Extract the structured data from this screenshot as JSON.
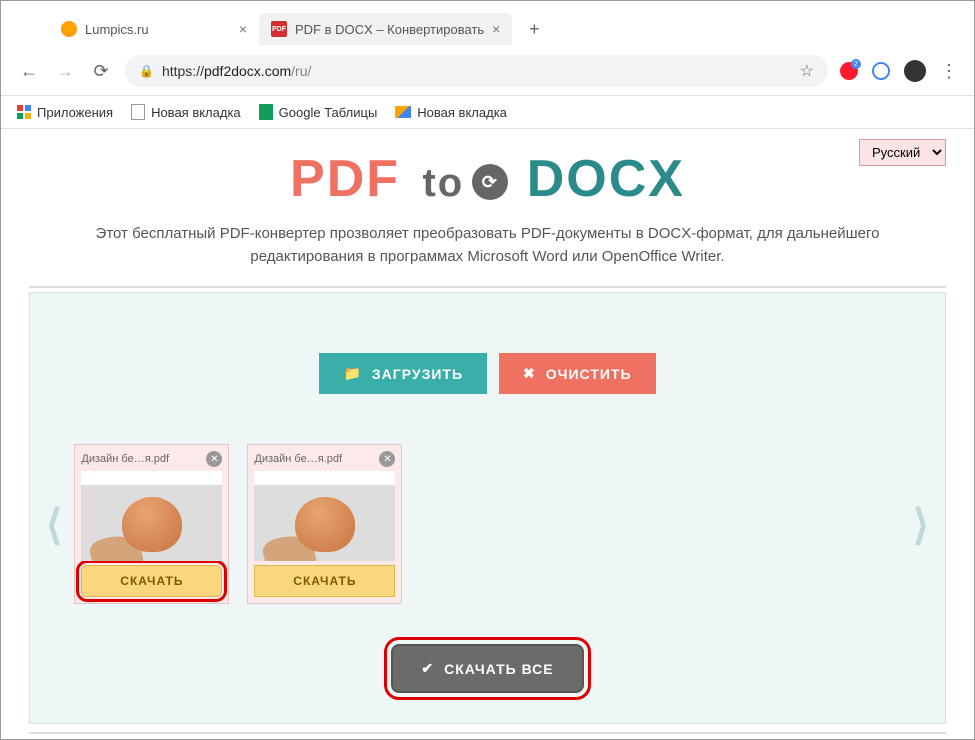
{
  "window": {
    "minimize": "—",
    "maximize": "☐",
    "close": "✕"
  },
  "tabs": [
    {
      "title": "Lumpics.ru"
    },
    {
      "title": "PDF в DOCX – Конвертировать"
    }
  ],
  "newTab": "+",
  "nav": {
    "back": "←",
    "forward": "→",
    "reload": "⟳"
  },
  "url": {
    "scheme": "https://",
    "domain": "pdf2docx.com",
    "path": "/ru/"
  },
  "star": "☆",
  "operaBadge": "2",
  "bookmarks": {
    "apps": "Приложения",
    "newTab1": "Новая вкладка",
    "sheets": "Google Таблицы",
    "newTab2": "Новая вкладка"
  },
  "langSelect": "Русский",
  "logo": {
    "pdf": "PDF",
    "to": "to",
    "docx": "DOCX"
  },
  "description": "Этот бесплатный PDF-конвертер прозволяет преобразовать PDF-документы в DOCX-формат, для дальнейшего редактирования в программах Microsoft Word или OpenOffice Writer.",
  "buttons": {
    "upload": "ЗАГРУЗИТЬ",
    "clear": "ОЧИСТИТЬ",
    "downloadAll": "СКАЧАТЬ ВСЕ"
  },
  "arrows": {
    "left": "⟨",
    "right": "⟩"
  },
  "files": [
    {
      "name": "Дизайн бе…я.pdf",
      "download": "СКАЧАТЬ"
    },
    {
      "name": "Дизайн бе…я.pdf",
      "download": "СКАЧАТЬ"
    }
  ],
  "icons": {
    "folder": "📁",
    "times": "✖",
    "check": "✔",
    "menuDots": "⋮"
  }
}
